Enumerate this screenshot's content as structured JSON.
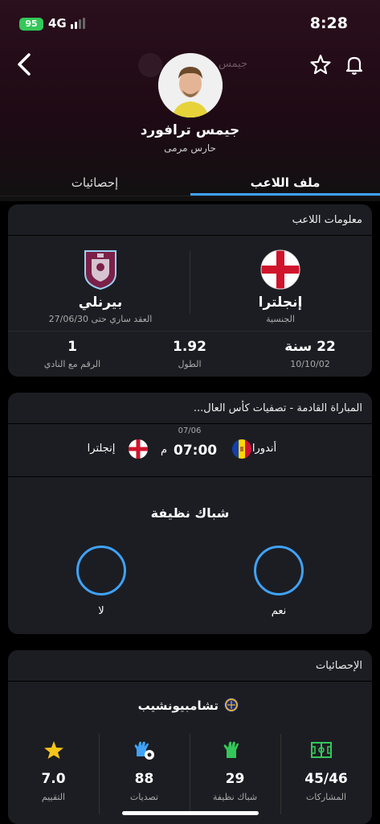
{
  "status_bar": {
    "battery": "95",
    "network": "4G",
    "time": "8:28"
  },
  "header": {
    "ghost_name": "جيمس",
    "player_name": "جيمس ترافورد",
    "player_role": "حارس مرمى"
  },
  "tabs": {
    "profile": "ملف اللاعب",
    "stats": "إحصائيات"
  },
  "player_info": {
    "title": "معلومات اللاعب",
    "country": "إنجلترا",
    "country_label": "الجنسية",
    "club": "بيرنلي",
    "contract_text": "العقد ساري حتى 27/06/30",
    "age": "22 سنة",
    "birth_date": "10/10/02",
    "height": "1.92",
    "height_label": "الطول",
    "shirt_number": "1",
    "shirt_label": "الرقم مع النادي"
  },
  "next_match": {
    "title": "المباراة القادمة - تصفيات كأس العال...",
    "date": "07/06",
    "time": "07:00",
    "ampm": "م",
    "home_team": "أندورا",
    "away_team": "إنجلترا",
    "poll_title": "شباك نظيفة",
    "yes_label": "نعم",
    "no_label": "لا"
  },
  "stats": {
    "title": "الإحصائيات",
    "competition": "تشامبيونشيب",
    "items": [
      {
        "value": "45/46",
        "label": "المشاركات",
        "icon": "pitch-icon"
      },
      {
        "value": "29",
        "label": "شباك نظيفة",
        "icon": "glove-icon"
      },
      {
        "value": "88",
        "label": "تصديات",
        "icon": "save-icon"
      },
      {
        "value": "7.0",
        "label": "التقييم",
        "icon": "star-icon"
      }
    ]
  },
  "colors": {
    "accent": "#3fa2f7",
    "battery": "#34c759",
    "card": "#1c1d22"
  }
}
